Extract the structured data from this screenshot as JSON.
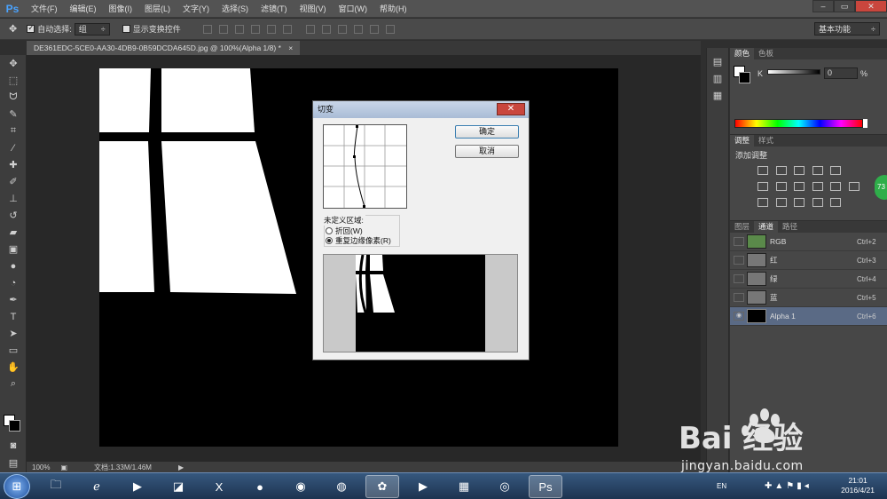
{
  "app": {
    "logo": "Ps"
  },
  "menu": [
    "文件(F)",
    "编辑(E)",
    "图像(I)",
    "图层(L)",
    "文字(Y)",
    "选择(S)",
    "滤镜(T)",
    "视图(V)",
    "窗口(W)",
    "帮助(H)"
  ],
  "window_controls": {
    "minimize": "–",
    "restore": "▭",
    "close": "✕"
  },
  "options": {
    "auto_select_label": "自动选择:",
    "auto_select_value": "组",
    "show_transform_label": "显示变换控件",
    "workspace": "基本功能"
  },
  "document": {
    "tab_title": "DE361EDC-5CE0-AA30-4DB9-0B59DCDA645D.jpg @ 100%(Alpha 1/8) *",
    "tab_close": "×"
  },
  "status": {
    "zoom": "100%",
    "doc_info": "文档:1.33M/1.46M"
  },
  "color_panel": {
    "tabs": [
      "颜色",
      "色板"
    ],
    "channel_label": "K",
    "value": "0",
    "unit": "%"
  },
  "adjust_panel": {
    "tabs": [
      "调整",
      "样式"
    ],
    "title": "添加调整"
  },
  "channels_panel": {
    "tabs": [
      "图层",
      "通道",
      "路径"
    ],
    "rows": [
      {
        "name": "RGB",
        "shortcut": "Ctrl+2"
      },
      {
        "name": "红",
        "shortcut": "Ctrl+3"
      },
      {
        "name": "绿",
        "shortcut": "Ctrl+4"
      },
      {
        "name": "蓝",
        "shortcut": "Ctrl+5"
      },
      {
        "name": "Alpha 1",
        "shortcut": "Ctrl+6"
      }
    ]
  },
  "dialog": {
    "title": "切变",
    "ok": "确定",
    "cancel": "取消",
    "undefined_area_label": "未定义区域:",
    "option_wrap": "折回(W)",
    "option_repeat": "重复边缘像素(R)",
    "selected_option": "repeat"
  },
  "badge": "73",
  "watermark": {
    "logo_text": "Bai 经验",
    "url": "jingyan.baidu.com"
  },
  "taskbar": {
    "lang": "EN",
    "time": "21:01",
    "date": "2016/4/21"
  }
}
